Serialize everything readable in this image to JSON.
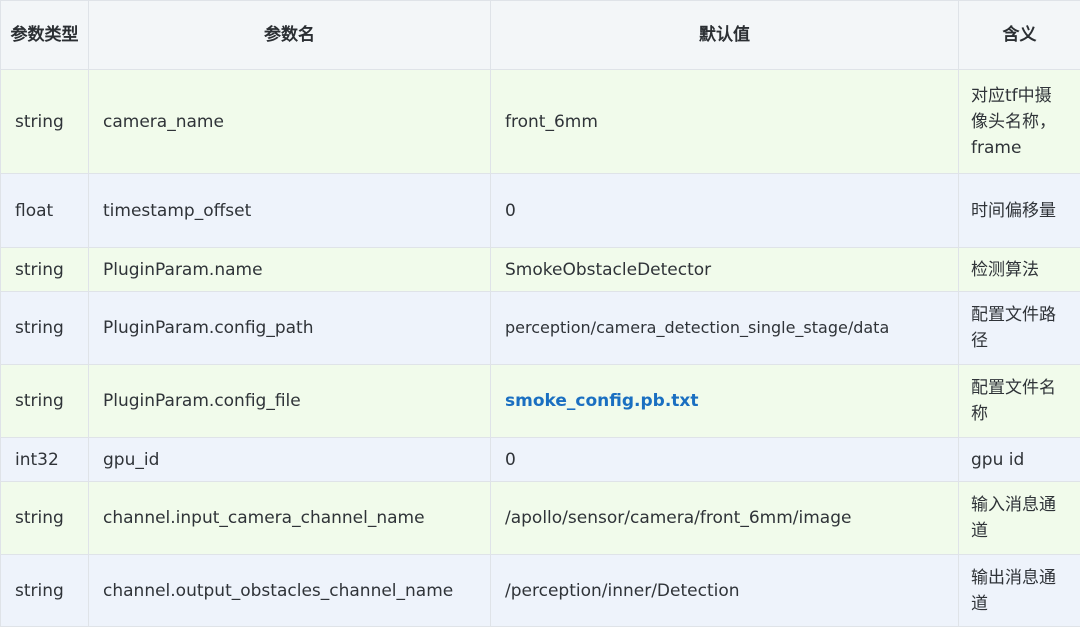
{
  "table": {
    "headers": [
      "参数类型",
      "参数名",
      "默认值",
      "含义"
    ],
    "rows": [
      {
        "type": "string",
        "name": "camera_name",
        "default": "front_6mm",
        "meaning": "对应tf中摄像头名称，frame"
      },
      {
        "type": "float",
        "name": "timestamp_offset",
        "default": "0",
        "meaning": "时间偏移量"
      },
      {
        "type": "string",
        "name": "PluginParam.name",
        "default": "SmokeObstacleDetector",
        "meaning": "检测算法"
      },
      {
        "type": "string",
        "name": "PluginParam.config_path",
        "default": "perception/camera_detection_single_stage/data",
        "meaning": "配置文件路径"
      },
      {
        "type": "string",
        "name": "PluginParam.config_file",
        "default": "smoke_config.pb.txt",
        "meaning": "配置文件名称"
      },
      {
        "type": "int32",
        "name": "gpu_id",
        "default": "0",
        "meaning": "gpu id"
      },
      {
        "type": "string",
        "name": "channel.input_camera_channel_name",
        "default": "/apollo/sensor/camera/front_6mm/image",
        "meaning": "输入消息通道"
      },
      {
        "type": "string",
        "name": "channel.output_obstacles_channel_name",
        "default": "/perception/inner/Detection",
        "meaning": "输出消息通道"
      }
    ]
  },
  "colors": {
    "odd_row": "#f1fbeb",
    "even_row": "#eef3fb",
    "header": "#f3f6f8",
    "link": "#1a6fc1"
  }
}
